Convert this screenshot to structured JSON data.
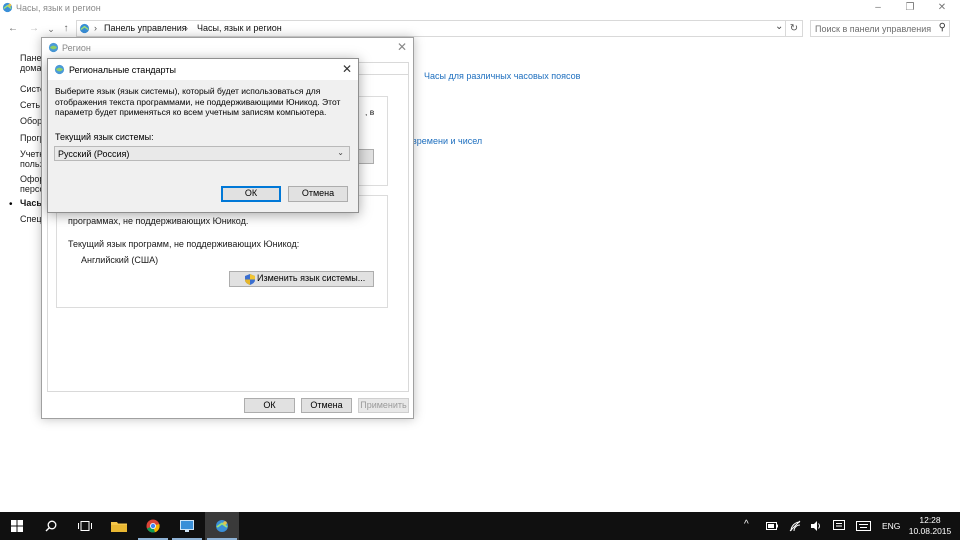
{
  "window": {
    "title": "Часы, язык и регион",
    "minimize": "–",
    "maximize": "❐",
    "close": "✕"
  },
  "nav": {
    "back": "←",
    "forward": "→",
    "recent": "⌄",
    "up": "↑"
  },
  "address": {
    "crumbs": [
      "Панель управления",
      "Часы, язык и регион"
    ],
    "separator": "›",
    "dropdown": "⌄",
    "refresh": "↻"
  },
  "search": {
    "placeholder": "Поиск в панели управления",
    "icon": "search-icon"
  },
  "leftpane": {
    "items": [
      "Панель управления — домашняя страница",
      "Система и безопасность",
      "Сеть и Интернет",
      "Оборудование и звук",
      "Программы",
      "Учетные записи пользователей",
      "Оформление и персонализация",
      "Часы, язык и регион",
      "Специальные возможности"
    ],
    "lines": [
      "Панел",
      "дома",
      "Систе",
      "Сеть и",
      "Обор",
      "Прогр",
      "Учетн",
      "польз",
      "Офор",
      "персо",
      "Часы",
      "Специ"
    ]
  },
  "main_links": {
    "timezones": "Часы для различных часовых поясов",
    "formats": "времени и чисел"
  },
  "region_dialog": {
    "title": "Регион",
    "close": "✕",
    "unicode_text_line": "программах, не поддерживающих Юникод.",
    "current_label": "Текущий язык программ, не поддерживающих Юникод:",
    "current_value": "Английский (США)",
    "change_button": "Изменить язык системы...",
    "ok": "ОК",
    "cancel": "Отмена",
    "apply": "Применить",
    "fragment_v": ", в"
  },
  "regional_standards": {
    "title": "Региональные стандарты",
    "close": "✕",
    "description": "Выберите язык (язык системы), который будет использоваться для отображения текста программами, не поддерживающими Юникод. Этот параметр будет применяться ко всем учетным записям компьютера.",
    "current_label": "Текущий язык системы:",
    "selected_language": "Русский (Россия)",
    "dropdown_arrow": "⌄",
    "ok": "ОК",
    "cancel": "Отмена"
  },
  "taskbar": {
    "apps": [
      "start-icon",
      "search-icon",
      "task-view-icon",
      "file-explorer-icon",
      "chrome-icon",
      "remote-desktop-icon",
      "control-panel-icon"
    ],
    "tray": {
      "chevron": "^",
      "language": "ENG",
      "time": "12:28",
      "date": "10.08.2015"
    }
  },
  "colors": {
    "accent": "#0078d7",
    "link": "#1e6fbf",
    "taskbar": "#101010"
  }
}
